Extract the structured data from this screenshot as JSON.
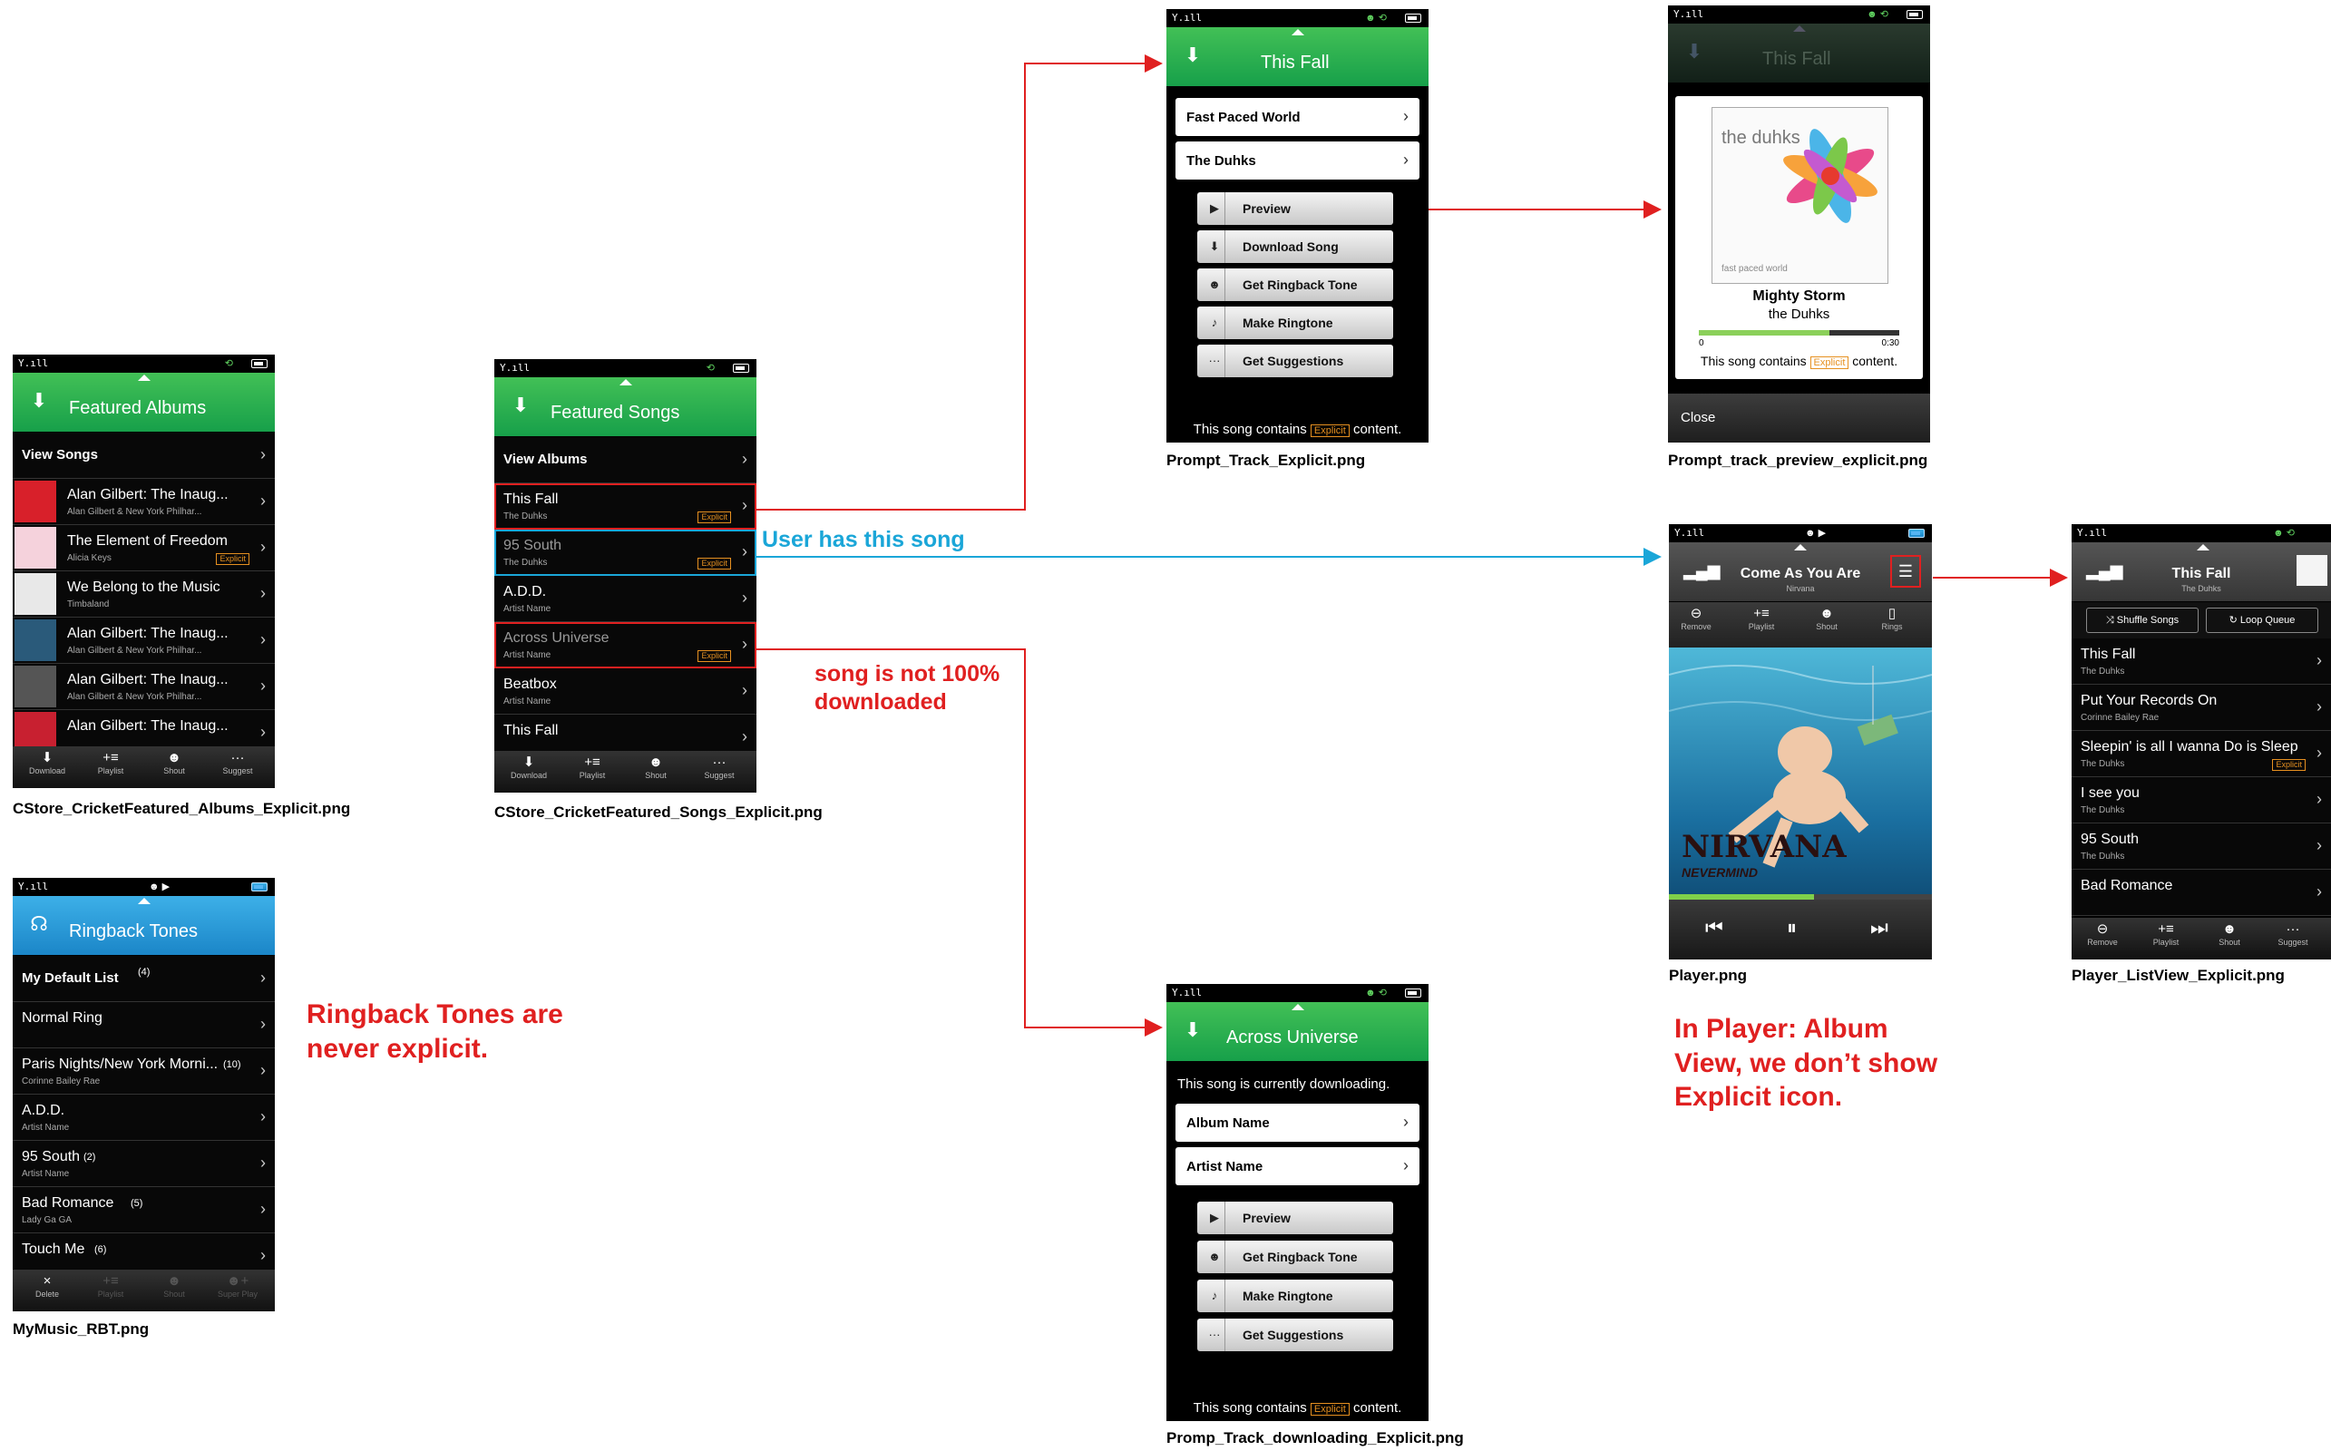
{
  "status": {
    "signal": "Y.ıll"
  },
  "albums": {
    "title": "Featured Albums",
    "caption": "CStore_CricketFeatured_Albums_Explicit.png",
    "view_songs": "View Songs",
    "rows": [
      {
        "t": "Alan Gilbert: The Inaug...",
        "s": "Alan Gilbert & New York Philhar..."
      },
      {
        "t": "The Element of Freedom",
        "s": "Alicia Keys",
        "badge": "Explicit"
      },
      {
        "t": "We Belong to the Music",
        "s": "Timbaland"
      },
      {
        "t": "Alan Gilbert: The Inaug...",
        "s": "Alan Gilbert & New York Philhar..."
      },
      {
        "t": "Alan Gilbert: The Inaug...",
        "s": "Alan Gilbert & New York Philhar..."
      },
      {
        "t": "Alan Gilbert: The Inaug...",
        "s": ""
      }
    ]
  },
  "toolbar": {
    "download": "Download",
    "playlist": "Playlist",
    "shout": "Shout",
    "suggest": "Suggest",
    "remove": "Remove",
    "rings": "Rings",
    "delete": "Delete",
    "superplay": "Super Play"
  },
  "songs": {
    "title": "Featured Songs",
    "caption": "CStore_CricketFeatured_Songs_Explicit.png",
    "view_albums": "View Albums",
    "rows": [
      {
        "t": "This Fall",
        "s": "The Duhks",
        "badge": "Explicit"
      },
      {
        "t": "95 South",
        "s": "The Duhks",
        "badge": "Explicit"
      },
      {
        "t": "A.D.D.",
        "s": "Artist Name"
      },
      {
        "t": "Across Universe",
        "s": "Artist Name",
        "badge": "Explicit"
      },
      {
        "t": "Beatbox",
        "s": "Artist Name"
      },
      {
        "t": "This Fall",
        "s": ""
      }
    ]
  },
  "rbt": {
    "title": "Ringback Tones",
    "caption": "MyMusic_RBT.png",
    "rows": [
      {
        "t": "My Default List",
        "c": "(4)",
        "s": ""
      },
      {
        "t": "Normal Ring",
        "c": "",
        "s": ""
      },
      {
        "t": "Paris Nights/New York Morni...",
        "c": "(10)",
        "s": "Corinne Bailey Rae"
      },
      {
        "t": "A.D.D.",
        "c": "",
        "s": "Artist Name"
      },
      {
        "t": "95 South",
        "c": "(2)",
        "s": "Artist Name"
      },
      {
        "t": "Bad Romance",
        "c": "(5)",
        "s": "Lady Ga GA"
      },
      {
        "t": "Touch Me",
        "c": "(6)",
        "s": ""
      }
    ]
  },
  "prompt": {
    "title": "This Fall",
    "caption": "Prompt_Track_Explicit.png",
    "buttons": [
      "Fast Paced World",
      "The Duhks"
    ],
    "actions": [
      "Preview",
      "Download Song",
      "Get Ringback Tone",
      "Make Ringtone",
      "Get Suggestions"
    ],
    "footer_pre": "This song contains",
    "badge": "Explicit",
    "footer_post": "content."
  },
  "preview": {
    "title": "This Fall",
    "caption": "Prompt_track_preview_explicit.png",
    "cover_brand": "the duhks",
    "cover_album": "fast paced world",
    "song": "Mighty Storm",
    "artist": "the Duhks",
    "time_start": "0",
    "time_end": "0:30",
    "progress": 0.65,
    "footer_pre": "This song contains",
    "badge": "Explicit",
    "footer_post": "content.",
    "close": "Close"
  },
  "downloading": {
    "title": "Across Universe",
    "caption": "Promp_Track_downloading_Explicit.png",
    "message": "This song is currently downloading.",
    "buttons": [
      "Album Name",
      "Artist Name"
    ],
    "actions": [
      "Preview",
      "Get Ringback Tone",
      "Make Ringtone",
      "Get Suggestions"
    ],
    "footer_pre": "This song contains",
    "badge": "Explicit",
    "footer_post": "content."
  },
  "player": {
    "caption": "Player.png",
    "title": "Come As You Are",
    "artist": "Nirvana",
    "cover_text": "NIRVANA",
    "cover_sub": "NEVERMIND",
    "progress": 0.55
  },
  "listview": {
    "caption": "Player_ListView_Explicit.png",
    "title": "This Fall",
    "artist": "The Duhks",
    "shuffle": "Shuffle Songs",
    "loop": "Loop Queue",
    "rows": [
      {
        "t": "This Fall",
        "s": "The Duhks"
      },
      {
        "t": "Put Your Records On",
        "s": "Corinne Bailey Rae"
      },
      {
        "t": "Sleepin' is all I wanna Do is Sleep",
        "s": "The Duhks",
        "badge": "Explicit"
      },
      {
        "t": "I see you",
        "s": "The Duhks"
      },
      {
        "t": "95 South",
        "s": "The Duhks"
      },
      {
        "t": "Bad Romance",
        "s": ""
      }
    ]
  },
  "notes": {
    "user_has": "User has this song",
    "not_downloaded_1": "song is not 100%",
    "not_downloaded_2": "downloaded",
    "rbt_1": "Ringback Tones are",
    "rbt_2": "never explicit.",
    "player_1": "In Player: Album",
    "player_2": "View, we don’t show",
    "player_3": "Explicit icon."
  }
}
